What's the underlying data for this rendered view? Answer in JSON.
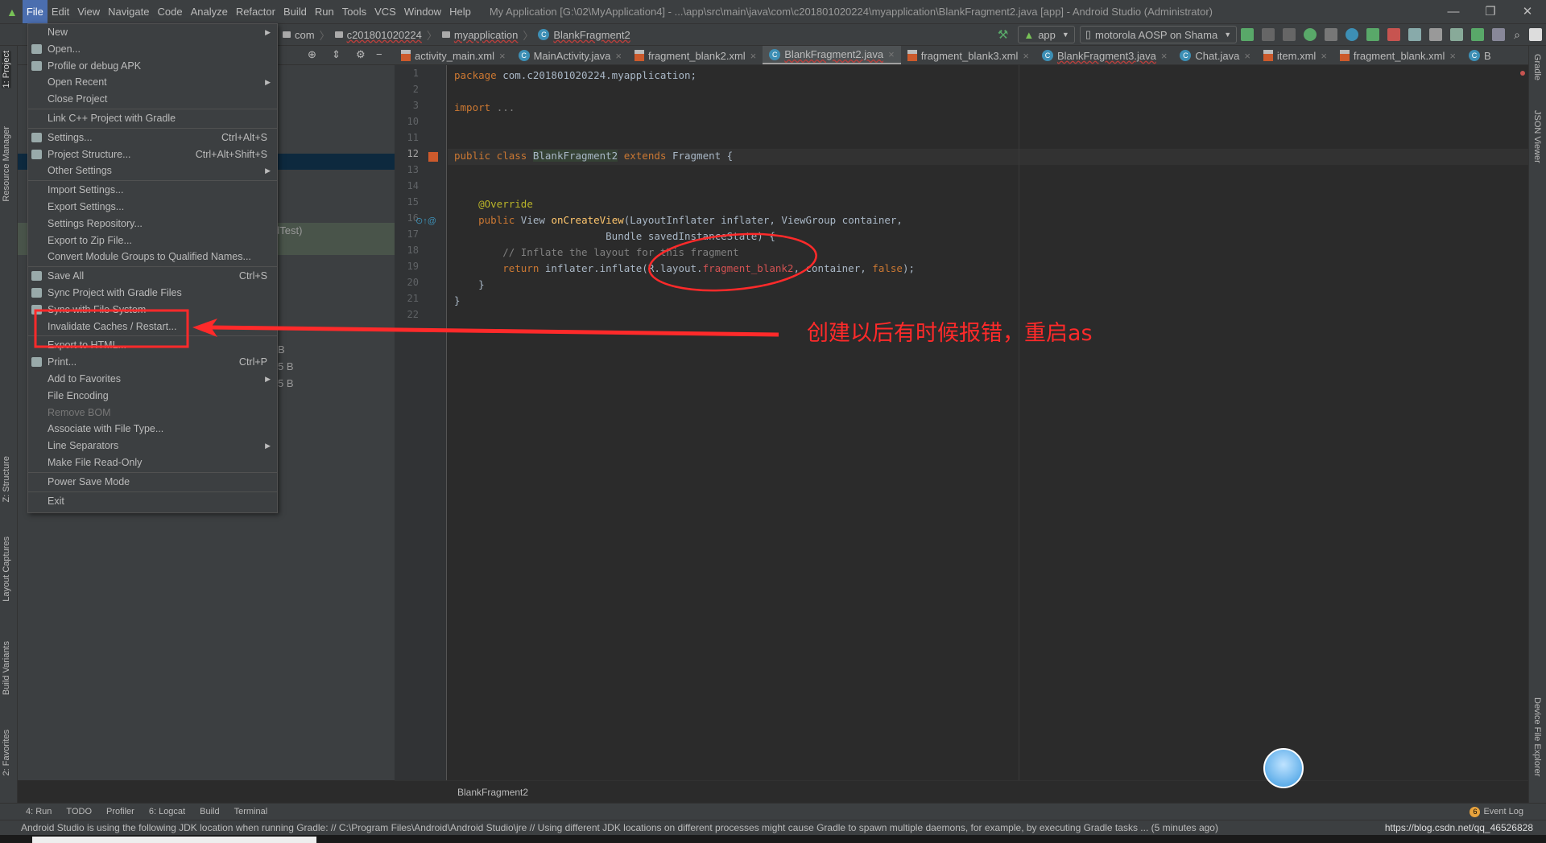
{
  "title_bar": {
    "menus": [
      "File",
      "Edit",
      "View",
      "Navigate",
      "Code",
      "Analyze",
      "Refactor",
      "Build",
      "Run",
      "Tools",
      "VCS",
      "Window",
      "Help"
    ],
    "title": "My Application [G:\\02\\MyApplication4] - ...\\app\\src\\main\\java\\com\\c201801020224\\myapplication\\BlankFragment2.java [app] - Android Studio (Administrator)",
    "min": "—",
    "max": "❐",
    "close": "✕"
  },
  "nav": {
    "crumbs": [
      "com",
      "c201801020224",
      "myapplication",
      "BlankFragment2"
    ],
    "run_config": "app",
    "device": "motorola AOSP on Shama"
  },
  "tabs": [
    {
      "label": "activity_main.xml",
      "type": "xml"
    },
    {
      "label": "MainActivity.java",
      "type": "java"
    },
    {
      "label": "fragment_blank2.xml",
      "type": "xml"
    },
    {
      "label": "BlankFragment2.java",
      "type": "java",
      "active": true
    },
    {
      "label": "fragment_blank3.xml",
      "type": "xml"
    },
    {
      "label": "BlankFragment3.java",
      "type": "java"
    },
    {
      "label": "Chat.java",
      "type": "java"
    },
    {
      "label": "item.xml",
      "type": "xml"
    },
    {
      "label": "fragment_blank.xml",
      "type": "xml"
    },
    {
      "label": "B",
      "type": "java"
    }
  ],
  "left_strip": [
    "1: Project",
    "Resource Manager",
    "Z: Structure",
    "Layout Captures",
    "Build Variants",
    "2: Favorites"
  ],
  "right_strip": [
    "Gradle",
    "JSON Viewer",
    "Device File Explorer"
  ],
  "project_fragments": [
    "dTest)",
    "B",
    "5 B",
    "5 B"
  ],
  "code": {
    "lines": [
      {
        "n": "1",
        "t": [
          [
            "kw",
            "package "
          ],
          [
            "",
            "com.c201801020224.myapplication;"
          ]
        ]
      },
      {
        "n": "2",
        "t": []
      },
      {
        "n": "3",
        "t": [
          [
            "kw",
            "import "
          ],
          [
            "cm",
            "..."
          ]
        ]
      },
      {
        "n": "10",
        "t": []
      },
      {
        "n": "11",
        "t": []
      },
      {
        "n": "12",
        "t": [
          [
            "kw",
            "public class "
          ],
          [
            "cls",
            "BlankFragment2"
          ],
          [
            "kw",
            " extends "
          ],
          [
            "",
            "Fragment {"
          ]
        ]
      },
      {
        "n": "13",
        "t": []
      },
      {
        "n": "14",
        "t": []
      },
      {
        "n": "15",
        "t": [
          [
            "",
            "    "
          ],
          [
            "an",
            "@Override"
          ]
        ]
      },
      {
        "n": "16",
        "t": [
          [
            "kw",
            "    public "
          ],
          [
            "",
            "View "
          ],
          [
            "fn",
            "onCreateView"
          ],
          [
            "",
            "(LayoutInflater inflater, ViewGroup container,"
          ]
        ]
      },
      {
        "n": "17",
        "t": [
          [
            "",
            "                         Bundle savedInstanceState) {"
          ]
        ]
      },
      {
        "n": "18",
        "t": [
          [
            "cm",
            "        // Inflate the layout for this fragment"
          ]
        ]
      },
      {
        "n": "19",
        "t": [
          [
            "kw",
            "        return "
          ],
          [
            "",
            "inflater.inflate(R.layout."
          ],
          [
            "rs",
            "fragment_blank2"
          ],
          [
            "",
            ", container, "
          ],
          [
            "kw",
            "false"
          ],
          [
            "",
            ");"
          ]
        ]
      },
      {
        "n": "20",
        "t": [
          [
            "",
            "    }"
          ]
        ]
      },
      {
        "n": "21",
        "t": [
          [
            "",
            "}"
          ]
        ]
      },
      {
        "n": "22",
        "t": []
      }
    ]
  },
  "editor_breadcrumb": "BlankFragment2",
  "file_menu": [
    {
      "label": "New",
      "sub": true
    },
    {
      "label": "Open...",
      "icon": "folder"
    },
    {
      "label": "Profile or debug APK",
      "icon": "apk"
    },
    {
      "label": "Open Recent",
      "sub": true
    },
    {
      "label": "Close Project"
    },
    {
      "sep": true
    },
    {
      "label": "Link C++ Project with Gradle"
    },
    {
      "sep": true
    },
    {
      "label": "Settings...",
      "shortcut": "Ctrl+Alt+S",
      "icon": "wrench"
    },
    {
      "label": "Project Structure...",
      "shortcut": "Ctrl+Alt+Shift+S",
      "icon": "structure"
    },
    {
      "label": "Other Settings",
      "sub": true
    },
    {
      "sep": true
    },
    {
      "label": "Import Settings..."
    },
    {
      "label": "Export Settings..."
    },
    {
      "label": "Settings Repository..."
    },
    {
      "label": "Export to Zip File..."
    },
    {
      "label": "Convert Module Groups to Qualified Names..."
    },
    {
      "sep": true
    },
    {
      "label": "Save All",
      "shortcut": "Ctrl+S",
      "icon": "save"
    },
    {
      "label": "Sync Project with Gradle Files",
      "icon": "sync-gradle"
    },
    {
      "label": "Sync with File System",
      "icon": "refresh"
    },
    {
      "label": "Invalidate Caches / Restart..."
    },
    {
      "sep": true
    },
    {
      "label": "Export to HTML..."
    },
    {
      "label": "Print...",
      "shortcut": "Ctrl+P",
      "icon": "print"
    },
    {
      "label": "Add to Favorites",
      "sub": true
    },
    {
      "label": "File Encoding"
    },
    {
      "label": "Remove BOM",
      "disabled": true
    },
    {
      "label": "Associate with File Type..."
    },
    {
      "label": "Line Separators",
      "sub": true
    },
    {
      "label": "Make File Read-Only"
    },
    {
      "sep": true
    },
    {
      "label": "Power Save Mode"
    },
    {
      "sep": true
    },
    {
      "label": "Exit"
    }
  ],
  "annotation": {
    "text": "创建以后有时候报错，重启as",
    "color": "#ff2a2a"
  },
  "bottom_tools": [
    "4: Run",
    "TODO",
    "Profiler",
    "6: Logcat",
    "Build",
    "Terminal"
  ],
  "event_log": {
    "count": "6",
    "label": "Event Log"
  },
  "status": "Android Studio is using the following JDK location when running Gradle: // C:\\Program Files\\Android\\Android Studio\\jre // Using different JDK locations on different processes might cause Gradle to spawn multiple daemons, for example, by executing Gradle tasks ... (5 minutes ago)",
  "watermark": "https://blog.csdn.net/qq_46526828"
}
